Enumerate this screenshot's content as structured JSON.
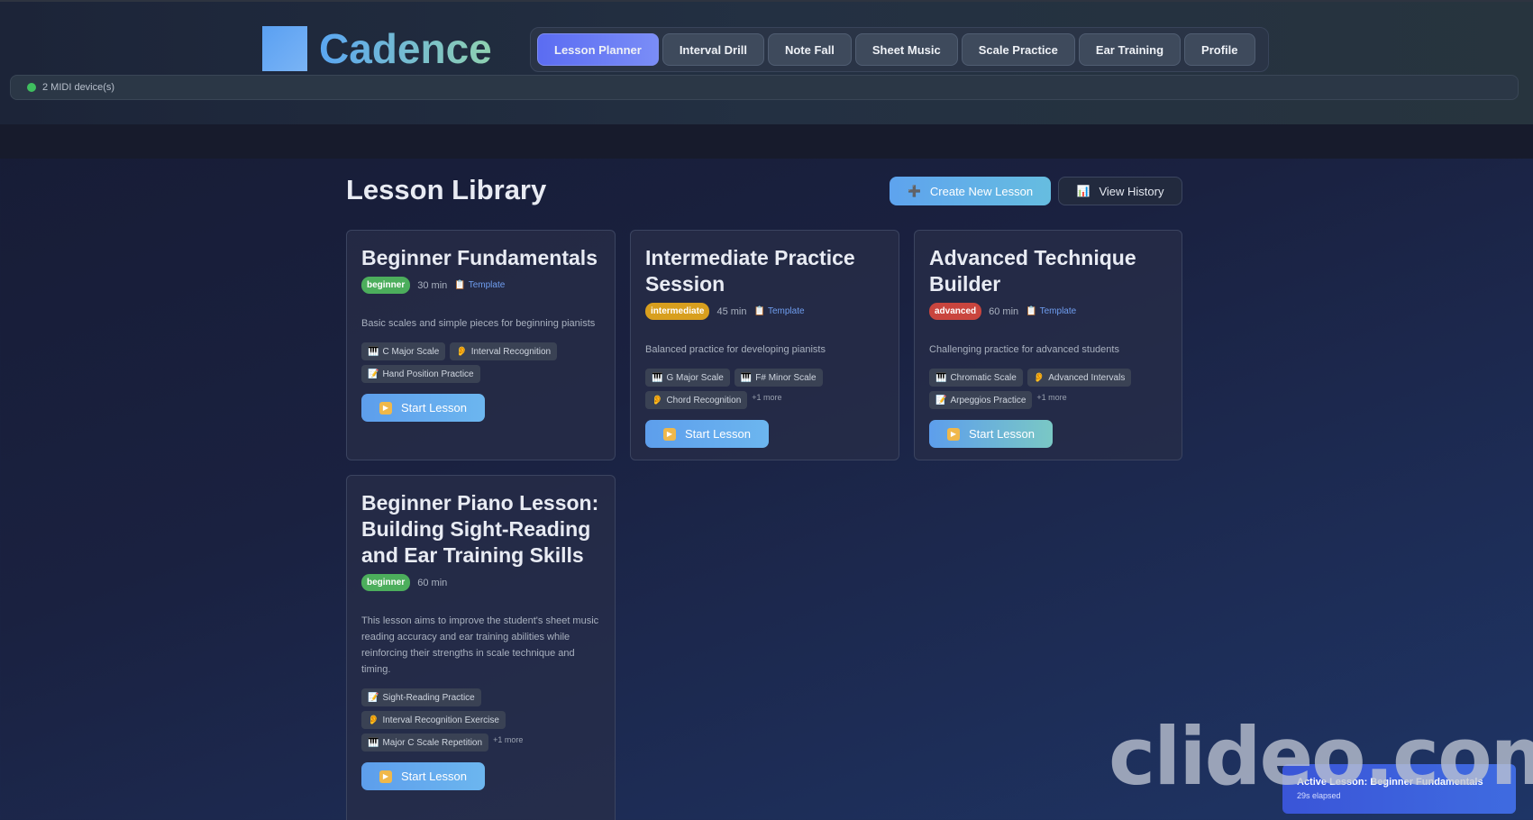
{
  "app": {
    "name": "Cadence"
  },
  "nav": {
    "tabs": [
      {
        "label": "Lesson Planner",
        "active": true
      },
      {
        "label": "Interval Drill"
      },
      {
        "label": "Note Fall"
      },
      {
        "label": "Sheet Music"
      },
      {
        "label": "Scale Practice"
      },
      {
        "label": "Ear Training"
      },
      {
        "label": "Profile"
      }
    ]
  },
  "midi": {
    "status": "2 MIDI device(s)"
  },
  "library": {
    "title": "Lesson Library",
    "create_label": "Create New Lesson",
    "history_label": "View History"
  },
  "lessons": [
    {
      "title": "Beginner Fundamentals",
      "level": "beginner",
      "duration": "30 min",
      "template": "Template",
      "description": "Basic scales and simple pieces for beginning pianists",
      "items": [
        "C Major Scale",
        "Interval Recognition",
        "Hand Position Practice"
      ],
      "more": "",
      "start_label": "Start Lesson"
    },
    {
      "title": "Intermediate Practice Session",
      "level": "intermediate",
      "duration": "45 min",
      "template": "Template",
      "description": "Balanced practice for developing pianists",
      "items": [
        "G Major Scale",
        "F# Minor Scale",
        "Chord Recognition"
      ],
      "more": "+1 more",
      "start_label": "Start Lesson"
    },
    {
      "title": "Advanced Technique Builder",
      "level": "advanced",
      "duration": "60 min",
      "template": "Template",
      "description": "Challenging practice for advanced students",
      "items": [
        "Chromatic Scale",
        "Advanced Intervals",
        "Arpeggios Practice"
      ],
      "more": "+1 more",
      "start_label": "Start Lesson"
    },
    {
      "title": "Beginner Piano Lesson: Building Sight-Reading and Ear Training Skills",
      "level": "beginner",
      "duration": "60 min",
      "template": "",
      "description": "This lesson aims to improve the student's sheet music reading accuracy and ear training abilities while reinforcing their strengths in scale technique and timing.",
      "items": [
        "Sight-Reading Practice",
        "Interval Recognition Exercise",
        "Major C Scale Repetition"
      ],
      "more": "+1 more",
      "start_label": "Start Lesson"
    }
  ],
  "toast": {
    "title": "Active Lesson: Beginner Fundamentals",
    "elapsed": "29s elapsed"
  },
  "watermark": {
    "text": "clideo.com"
  },
  "icons": {
    "create": "plus-icon",
    "history": "bar-chart-icon",
    "template": "clipboard-icon",
    "piano": "piano-icon",
    "ear": "ear-icon",
    "notes": "memo-icon",
    "play": "play-icon"
  }
}
